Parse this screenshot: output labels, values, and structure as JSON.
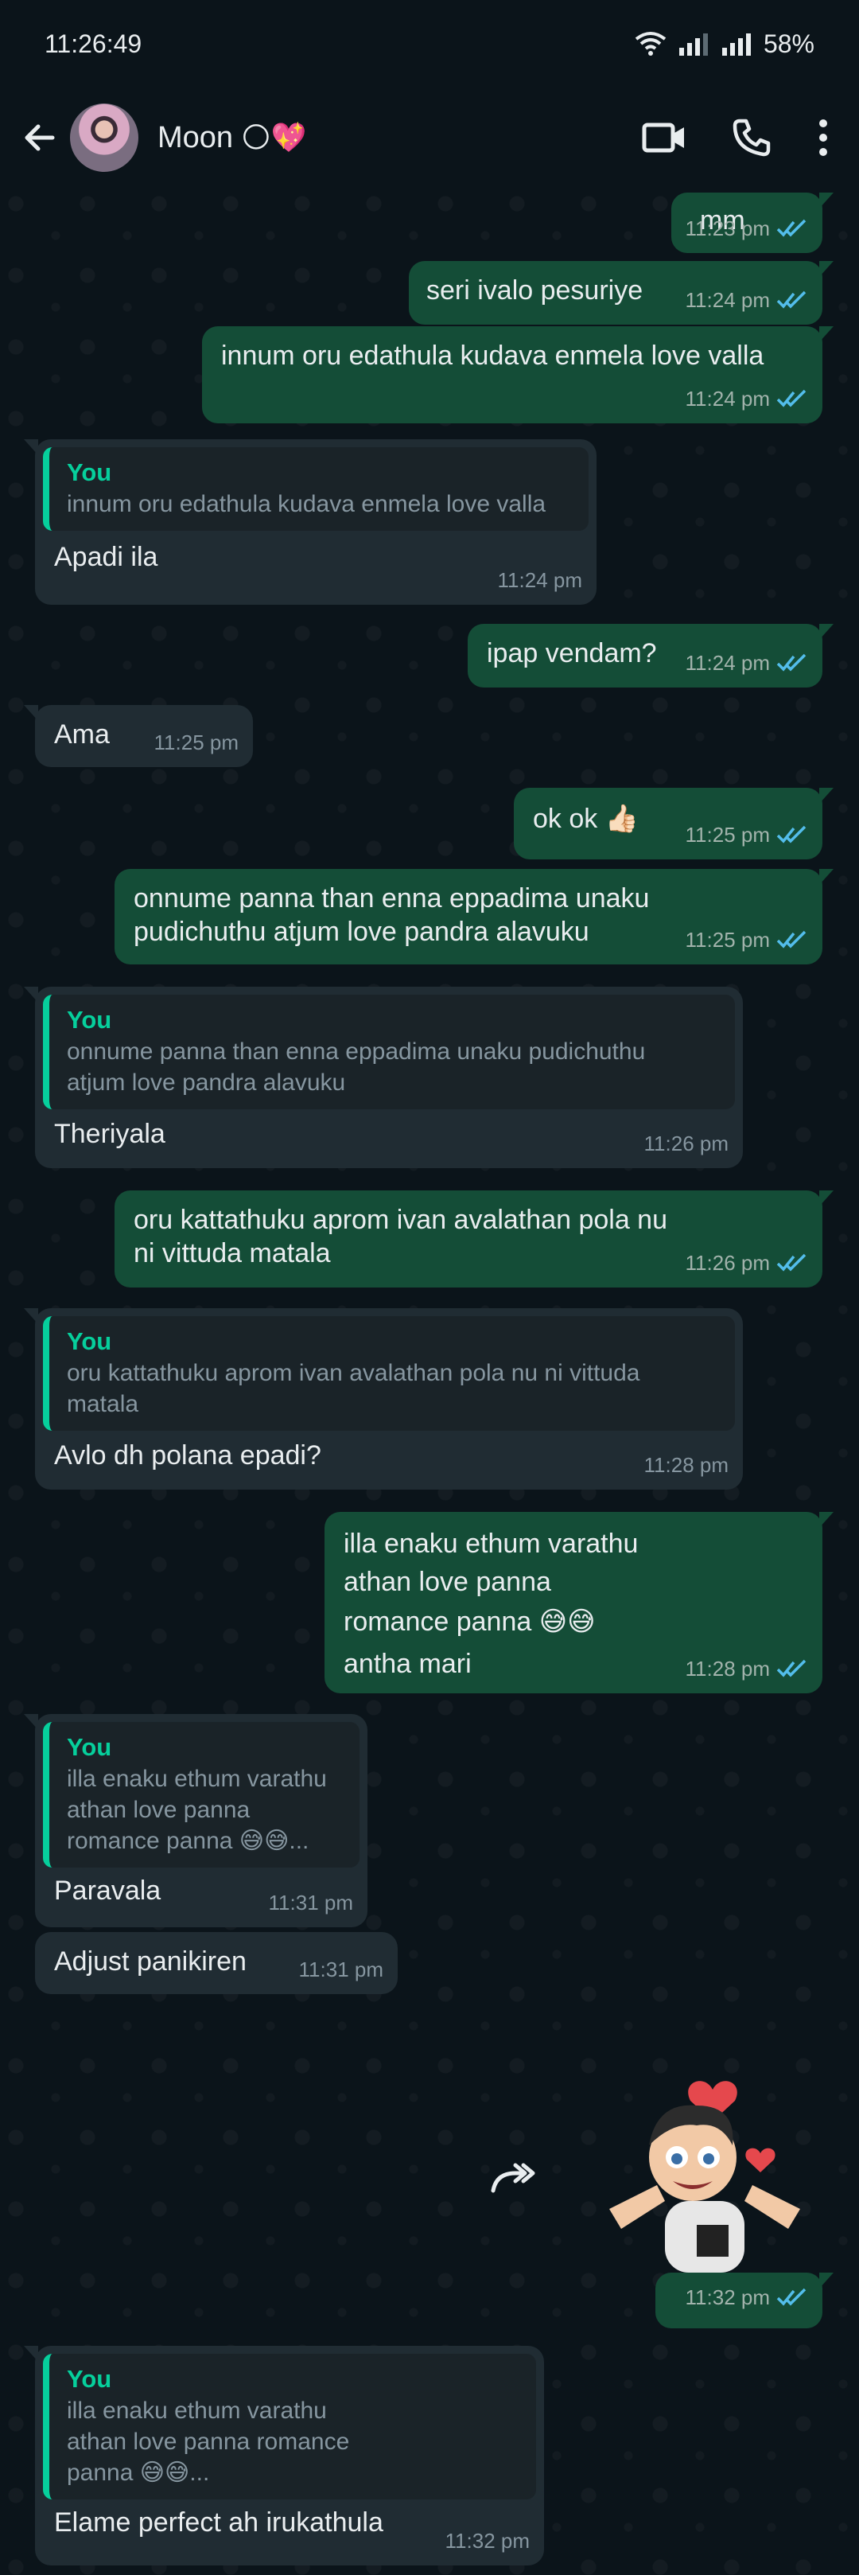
{
  "status_bar": {
    "time": "11:26:49",
    "battery": "58%"
  },
  "header": {
    "contact_name": "Moon",
    "contact_emoji": "🌕💖"
  },
  "messages": [
    {
      "text": "mm",
      "time": "11:23 pm"
    },
    {
      "text": "seri ivalo pesuriye",
      "time": "11:24 pm"
    },
    {
      "text": "innum oru edathula kudava enmela love valla",
      "time": "11:24 pm"
    },
    {
      "quote_author": "You",
      "quote_text": "innum oru edathula kudava enmela love valla",
      "text": "Apadi ila",
      "time": "11:24 pm"
    },
    {
      "text": "ipap vendam?",
      "time": "11:24 pm"
    },
    {
      "text": "Ama",
      "time": "11:25 pm"
    },
    {
      "text": "ok ok 👍🏻",
      "time": "11:25 pm"
    },
    {
      "text": "onnume panna than enna eppadima unaku pudichuthu atjum love pandra alavuku",
      "time": "11:25 pm"
    },
    {
      "quote_author": "You",
      "quote_text": "onnume panna than enna eppadima unaku pudichuthu atjum love pandra alavuku",
      "text": "Theriyala",
      "time": "11:26 pm"
    },
    {
      "text": "oru kattathuku aprom ivan avalathan pola nu ni vittuda matala",
      "time": "11:26 pm"
    },
    {
      "quote_author": "You",
      "quote_text": "oru kattathuku aprom ivan avalathan pola nu ni vittuda matala",
      "text": "Avlo dh polana epadi?",
      "time": "11:28 pm"
    },
    {
      "lines": [
        "illa enaku ethum varathu",
        "athan love panna",
        "romance panna 😅😅",
        "antha mari"
      ],
      "time": "11:28 pm"
    },
    {
      "quote_author": "You",
      "quote_text": "illa enaku ethum varathu athan love panna romance panna 😅😅...",
      "text": "Paravala",
      "time": "11:31 pm"
    },
    {
      "text": "Adjust panikiren",
      "time": "11:31 pm"
    },
    {
      "sticker": "sticker-man-with-hearts",
      "time": "11:32 pm"
    },
    {
      "quote_author": "You",
      "quote_text": "illa enaku ethum varathu athan love panna romance panna 😅😅...",
      "text": "Elame perfect ah irukathula",
      "time": "11:32 pm"
    }
  ],
  "colors": {
    "background": "#0b141a",
    "outgoing_bubble": "#144d37",
    "incoming_bubble": "#202c33",
    "read_check": "#53bdeb",
    "quote_accent": "#06cf9c"
  }
}
